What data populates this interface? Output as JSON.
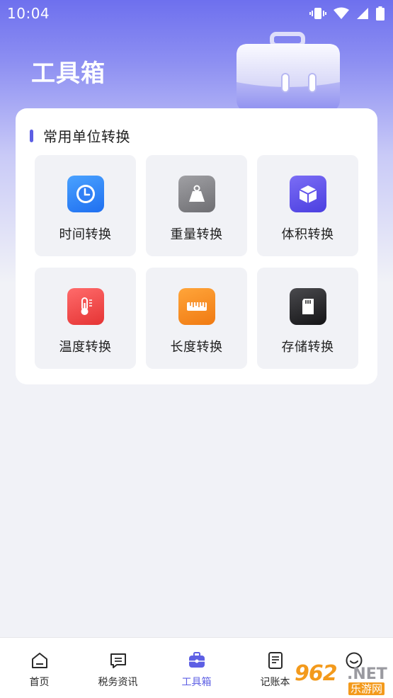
{
  "status_bar": {
    "time": "10:04"
  },
  "page": {
    "title": "工具箱"
  },
  "section": {
    "title": "常用单位转换"
  },
  "tools": [
    {
      "label": "时间转换",
      "icon": "clock-icon",
      "color": "#2f7ff5"
    },
    {
      "label": "重量转换",
      "icon": "weight-icon",
      "color": "#8a8a8e"
    },
    {
      "label": "体积转换",
      "icon": "cube-icon",
      "color": "#5b4ee8"
    },
    {
      "label": "温度转换",
      "icon": "thermometer-icon",
      "color": "#f04848"
    },
    {
      "label": "长度转换",
      "icon": "ruler-icon",
      "color": "#f5861f"
    },
    {
      "label": "存储转换",
      "icon": "sd-card-icon",
      "color": "#2a2a2a"
    }
  ],
  "tabbar": {
    "active_color": "#5d5fe4",
    "items": [
      {
        "label": "首页",
        "icon": "home-icon"
      },
      {
        "label": "税务资讯",
        "icon": "message-icon"
      },
      {
        "label": "工具箱",
        "icon": "toolbox-icon",
        "active": true
      },
      {
        "label": "记账本",
        "icon": "notebook-icon"
      },
      {
        "label": "",
        "icon": "smiley-icon"
      }
    ]
  },
  "watermark": {
    "number": "962",
    "domain": ".NET",
    "site": "乐游网"
  }
}
